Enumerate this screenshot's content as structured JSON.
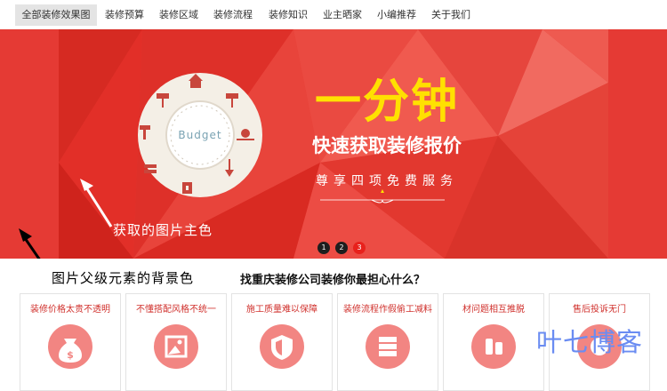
{
  "nav": {
    "items": [
      {
        "label": "全部装修效果图",
        "active": true
      },
      {
        "label": "装修预算"
      },
      {
        "label": "装修区域"
      },
      {
        "label": "装修流程"
      },
      {
        "label": "装修知识"
      },
      {
        "label": "业主晒家"
      },
      {
        "label": "小编推荐"
      },
      {
        "label": "关于我们"
      }
    ]
  },
  "banner": {
    "headline": "一分钟",
    "subhead": "快速获取装修报价",
    "tagline": "尊享四项免费服务",
    "dial_label": "Budget",
    "dots": [
      "1",
      "2",
      "3"
    ],
    "active_dot": 3,
    "colors": {
      "base": "#e53a34",
      "headline": "#ffe100"
    }
  },
  "annotations": {
    "main_color": "获取的图片主色",
    "parent_bg": "图片父级元素的背景色"
  },
  "section": {
    "title": "找重庆装修公司装修你最担心什么？",
    "cards": [
      {
        "label": "装修价格太贵不透明",
        "icon": "money-bag-icon"
      },
      {
        "label": "不懂搭配风格不统一",
        "icon": "picture-icon"
      },
      {
        "label": "施工质量难以保障",
        "icon": "shield-icon"
      },
      {
        "label": "装修流程作假偷工减料",
        "icon": "server-icon"
      },
      {
        "label": "材问题相互推脱",
        "icon": "tools-icon"
      },
      {
        "label": "售后投诉无门",
        "icon": "complaint-icon"
      }
    ]
  },
  "watermark": "叶七博客"
}
